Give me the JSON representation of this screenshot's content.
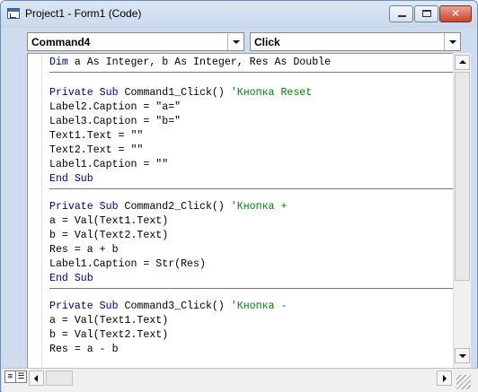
{
  "window": {
    "title": "Project1 - Form1 (Code)"
  },
  "object_combo": {
    "value": "Command4"
  },
  "procedure_combo": {
    "value": "Click"
  },
  "code": {
    "declarations": {
      "keyword": "Dim ",
      "text": "a As Integer, b As Integer, Res As Double"
    },
    "procedures": [
      {
        "header_keyword": "Private Sub ",
        "header_name": "Command1_Click() ",
        "header_comment": "'Кнопка Reset",
        "body": [
          "Label2.Caption = \"a=\"",
          "Label3.Caption = \"b=\"",
          "Text1.Text = \"\"",
          "Text2.Text = \"\"",
          "Label1.Caption = \"\""
        ],
        "end": "End Sub"
      },
      {
        "header_keyword": "Private Sub ",
        "header_name": "Command2_Click() ",
        "header_comment": "'Кнопка +",
        "body": [
          "a = Val(Text1.Text)",
          "b = Val(Text2.Text)",
          "Res = a + b",
          "Label1.Caption = Str(Res)"
        ],
        "end": "End Sub"
      },
      {
        "header_keyword": "Private Sub ",
        "header_name": "Command3_Click() ",
        "header_comment": "'Кнопка -",
        "body": [
          "a = Val(Text1.Text)",
          "b = Val(Text2.Text)",
          "Res = a - b"
        ],
        "end": ""
      }
    ]
  },
  "colors": {
    "keyword": "#00008b",
    "comment": "#008000",
    "title_close": "#c9422b"
  },
  "icons": [
    "app-icon",
    "minimize-icon",
    "maximize-icon",
    "close-icon",
    "chevron-down-icon",
    "procedure-view-icon",
    "full-module-view-icon"
  ]
}
